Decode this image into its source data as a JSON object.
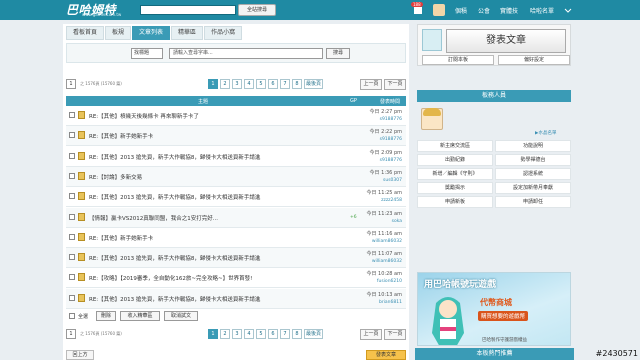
{
  "topbar": {
    "logo": "巴哈姆特",
    "logo_url": "www.gamer.com.tw",
    "search_button": "全站搜尋",
    "notif_count": "188",
    "links": [
      "個積",
      "公會",
      "實體技",
      "哈啦名單"
    ]
  },
  "tabs": [
    "看板首頁",
    "板規",
    "文章列表",
    "精華區",
    "作品小窩"
  ],
  "filter": {
    "select_value": "找標題",
    "keyword_placeholder": "請輸入查尋字串...",
    "search_button": "搜尋"
  },
  "pager": {
    "current": "1",
    "info": "之 1576頁 (15760 篇)",
    "pages": [
      "1",
      "2",
      "3",
      "4",
      "5",
      "6",
      "7",
      "8"
    ],
    "last_page": "最後頁",
    "prev": "上一頁",
    "next": "下一頁"
  },
  "table": {
    "col_title": "主題",
    "col_gp": "GP",
    "col_time": "發表時間",
    "rows": [
      {
        "title": "RE:【其他】槓幾天後幾條卡 再來聊新手卡了",
        "gp": "",
        "time": "今日 2:27 pm",
        "author": "s9188776"
      },
      {
        "title": "RE:【其他】新手她新手卡",
        "gp": "",
        "time": "今日 2:22 pm",
        "author": "s9188776"
      },
      {
        "title": "RE:【其他】2013 搶先頁，新手大作戰協8，歸侵卡大相送頁新手請進",
        "gp": "",
        "time": "今日 2:09 pm",
        "author": "s9188776"
      },
      {
        "title": "RE:【討論】多新交易",
        "gp": "",
        "time": "今日 1:36 pm",
        "author": "sus0307"
      },
      {
        "title": "RE:【其他】2013 搶先頁，新手大作戰協8，歸侵卡大相送頁新手請進",
        "gp": "",
        "time": "今日 11:25 am",
        "author": "zzzz2458"
      },
      {
        "title": "【情報】贏卡VS2012真聯同盟，我合之1安打完好...",
        "gp": "+6",
        "time": "今日 11:23 am",
        "author": "soka"
      },
      {
        "title": "RE:【其他】新手她新手卡",
        "gp": "",
        "time": "今日 11:16 am",
        "author": "william86032"
      },
      {
        "title": "RE:【其他】2013 搶先頁，新手大作戰協8，歸侵卡大相送頁新手請進",
        "gp": "",
        "time": "今日 11:07 am",
        "author": "william86032"
      },
      {
        "title": "RE:【攻略】【2019審季，全自動化162旅~完全攻略~】世界首發!",
        "gp": "",
        "time": "今日 10:28 am",
        "author": "fusion6210"
      },
      {
        "title": "RE:【其他】2013 搶先頁，新手大作戰協8，歸侵卡大相送頁新手請進",
        "gp": "",
        "time": "今日 10:13 am",
        "author": "brian6811"
      }
    ]
  },
  "actions": {
    "select_all": "全選",
    "delete": "刪除",
    "collect": "收入精華區",
    "cancel_post": "取消試文"
  },
  "side": {
    "publish": "發表文章",
    "subscribe": "訂閱本板",
    "pref": "偏好設定",
    "moderators_title": "板務人員",
    "more_mods": "▶水晶名單",
    "grid": [
      "新主席交流區",
      "功能說明",
      "出勤紀錄",
      "勢學禪德台",
      "新增／編輯《守則》",
      "認證系統",
      "獎勵揭示",
      "設定加新帶月奉獻",
      "申請新板",
      "申請卸任"
    ],
    "ad_title": "用巴哈帳號玩遊戲",
    "ad_sub": "代幣商城",
    "ad_buy": "購買想要的遊戲幣",
    "ad_foot": "巴哈製作守護游戲權益",
    "hot_title": "本板熱門推薦"
  },
  "footer": {
    "left_btn": "回上方",
    "right_btn": "發表文章"
  },
  "watermark": "#2430571"
}
